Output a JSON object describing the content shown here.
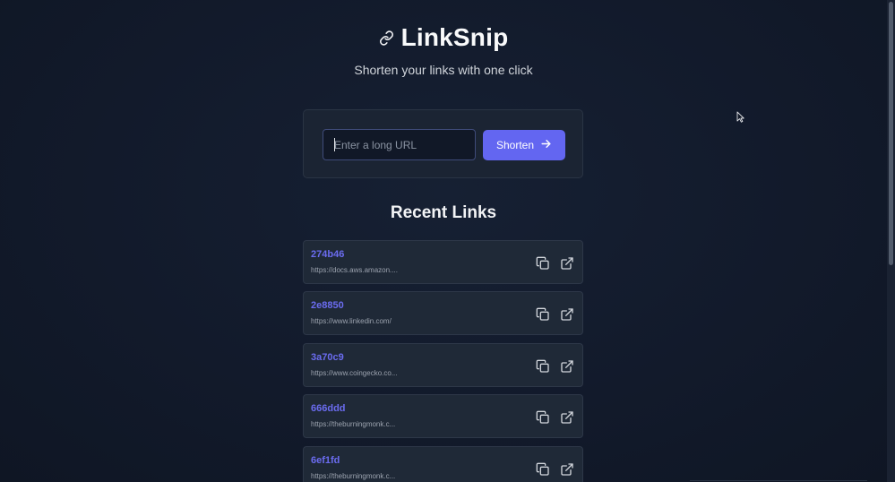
{
  "app": {
    "title": "LinkSnip",
    "subtitle": "Shorten your links with one click"
  },
  "form": {
    "url_placeholder": "Enter a long URL",
    "url_value": "",
    "submit_label": "Shorten"
  },
  "recent": {
    "heading": "Recent Links",
    "links": [
      {
        "code": "274b46",
        "url": "https://docs.aws.amazon...."
      },
      {
        "code": "2e8850",
        "url": "https://www.linkedin.com/"
      },
      {
        "code": "3a70c9",
        "url": "https://www.coingecko.co..."
      },
      {
        "code": "666ddd",
        "url": "https://theburningmonk.c..."
      },
      {
        "code": "6ef1fd",
        "url": "https://theburningmonk.c..."
      }
    ]
  },
  "icons": {
    "logo": "link-icon",
    "submit": "arrow-right-icon",
    "copy": "copy-icon",
    "open": "external-link-icon"
  },
  "colors": {
    "accent": "#6366f1",
    "background": "#111827",
    "card": "#1f2937",
    "link_code": "#6b6cf0"
  }
}
